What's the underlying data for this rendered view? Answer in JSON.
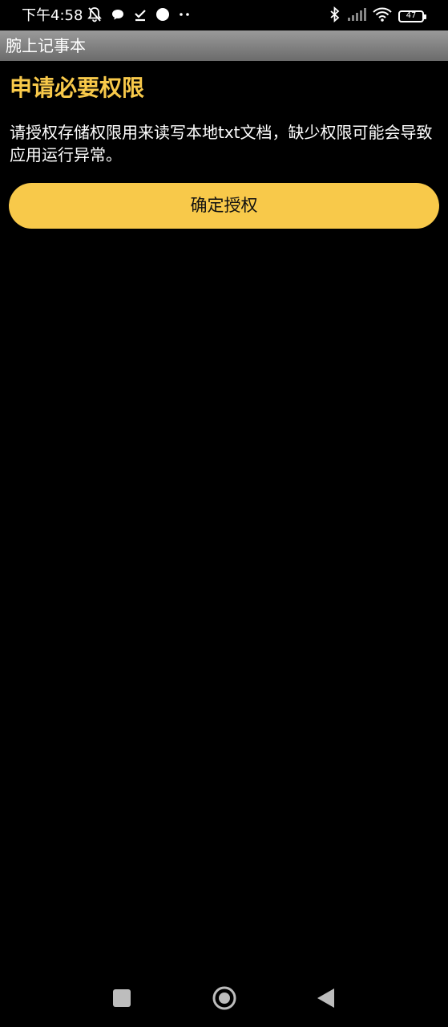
{
  "status_bar": {
    "time": "下午4:58",
    "battery_level": "47",
    "icons_left": [
      "bell-muted-icon",
      "chat-bubble-icon",
      "download-done-icon",
      "circle-icon",
      "more-dots-icon"
    ],
    "icons_right": [
      "bluetooth-icon",
      "signal-icon",
      "wifi-icon",
      "battery-icon"
    ]
  },
  "app_bar": {
    "title": "腕上记事本"
  },
  "permission": {
    "heading": "申请必要权限",
    "description": "请授权存储权限用来读写本地txt文档，缺少权限可能会导致应用运行异常。",
    "confirm_label": "确定授权"
  },
  "nav_bar": {
    "icons": [
      "recent-apps-icon",
      "home-icon",
      "back-icon"
    ]
  },
  "colors": {
    "accent": "#f8c94a",
    "background": "#000000",
    "app_bar": "#8a8a8a"
  }
}
